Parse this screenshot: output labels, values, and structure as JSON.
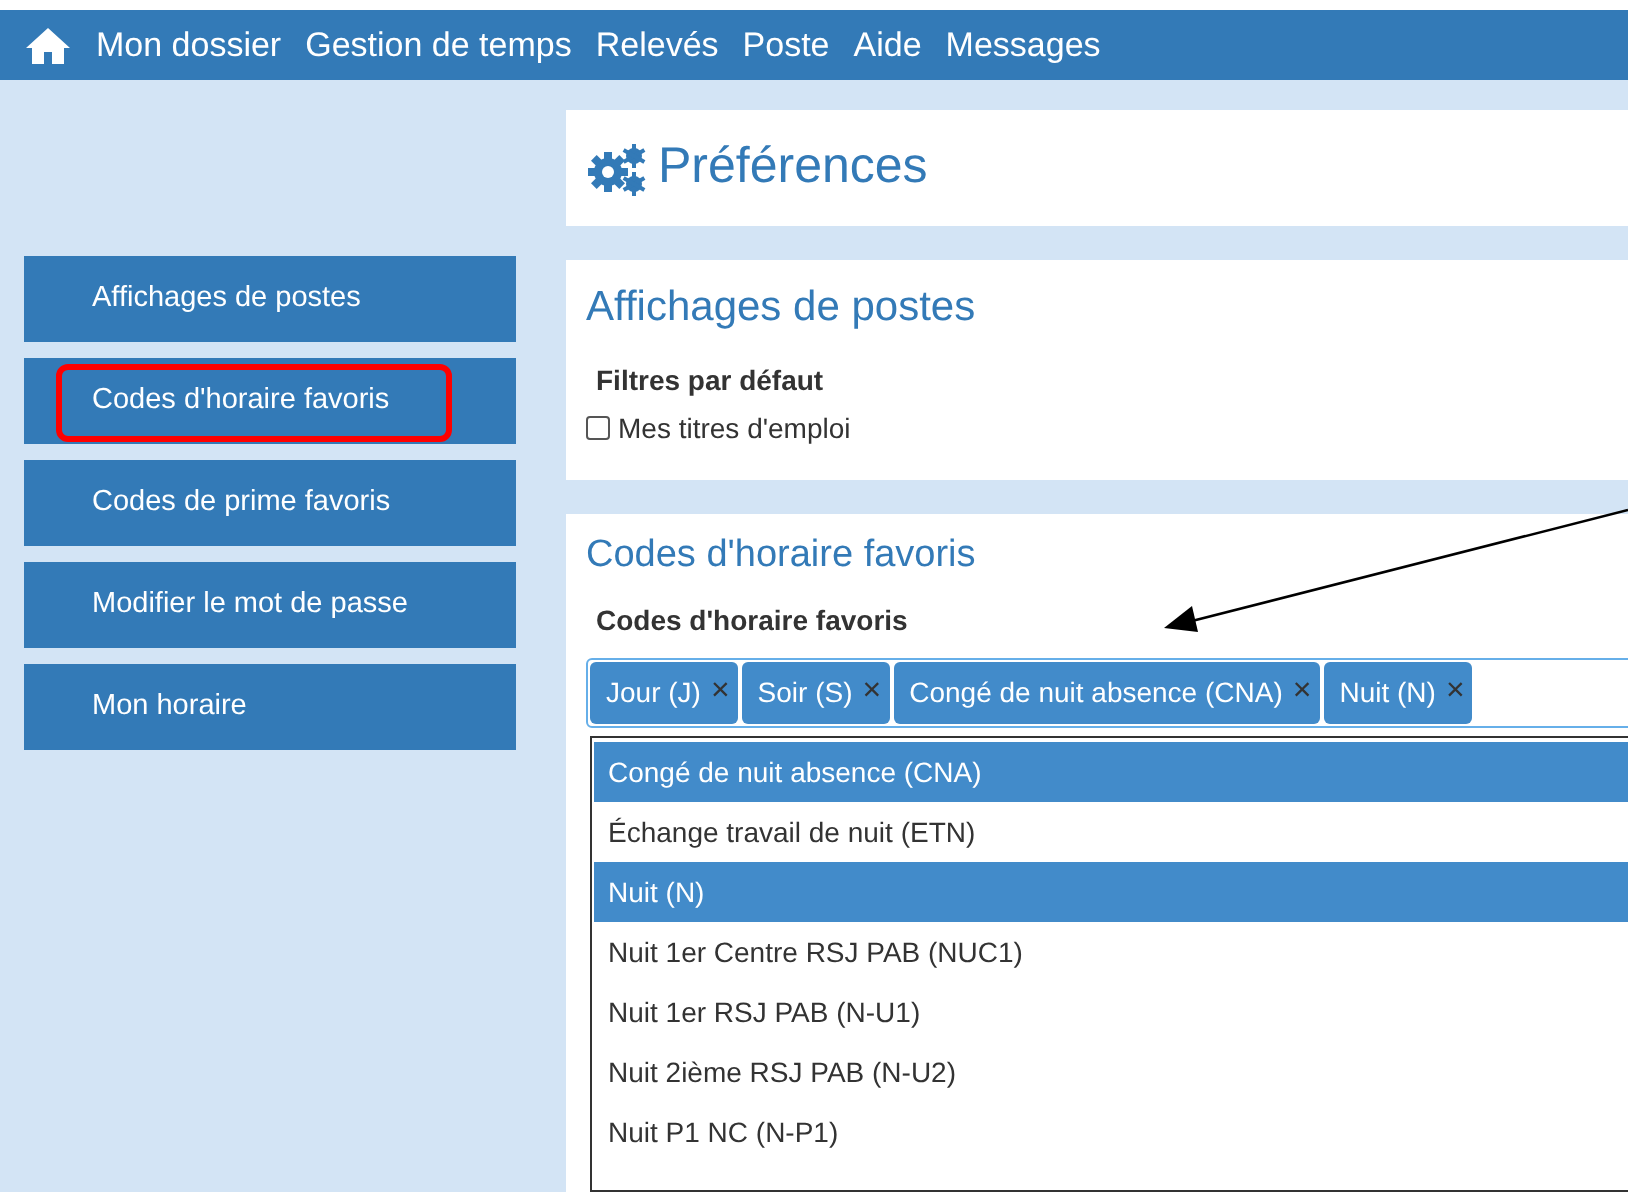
{
  "nav": {
    "items": [
      "Mon dossier",
      "Gestion de temps",
      "Relevés",
      "Poste",
      "Aide",
      "Messages"
    ]
  },
  "page_title": "Préférences",
  "sidebar": {
    "items": [
      {
        "label": "Affichages de postes",
        "highlighted": false
      },
      {
        "label": "Codes d'horaire favoris",
        "highlighted": true
      },
      {
        "label": "Codes de prime favoris",
        "highlighted": false
      },
      {
        "label": "Modifier le mot de passe",
        "highlighted": false
      },
      {
        "label": "Mon horaire",
        "highlighted": false
      }
    ]
  },
  "section_displays": {
    "title": "Affichages de postes",
    "label": "Filtres par défaut",
    "checkbox": {
      "label": "Mes titres d'emploi",
      "checked": false
    }
  },
  "section_codes": {
    "title": "Codes d'horaire favoris",
    "label": "Codes d'horaire favoris",
    "tags": [
      "Jour (J)",
      "Soir (S)",
      "Congé de nuit absence (CNA)",
      "Nuit (N)"
    ],
    "remove_symbol": "×",
    "options": [
      {
        "label": "Congé de nuit absence (CNA)",
        "selected": true
      },
      {
        "label": "Échange travail de nuit (ETN)",
        "selected": false
      },
      {
        "label": "Nuit (N)",
        "selected": true
      },
      {
        "label": "Nuit 1er Centre RSJ PAB (NUC1)",
        "selected": false
      },
      {
        "label": "Nuit 1er RSJ PAB (N-U1)",
        "selected": false
      },
      {
        "label": "Nuit 2ième RSJ PAB (N-U2)",
        "selected": false
      },
      {
        "label": "Nuit P1 NC (N-P1)",
        "selected": false
      }
    ]
  }
}
